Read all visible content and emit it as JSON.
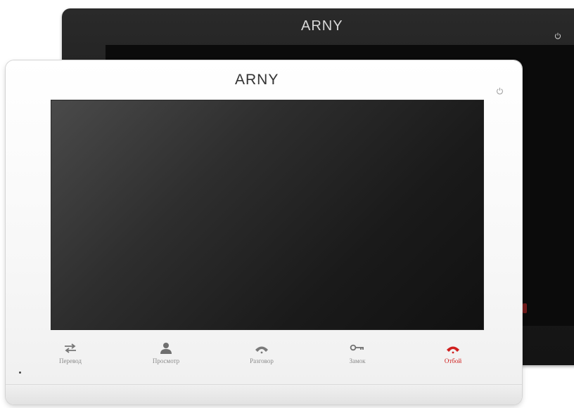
{
  "black_monitor": {
    "brand": "ARNY"
  },
  "white_monitor": {
    "brand": "ARNY",
    "buttons": [
      {
        "label": "Перевод",
        "icon": "transfer-arrows-icon",
        "color": "#8a8a8a"
      },
      {
        "label": "Просмотр",
        "icon": "person-icon",
        "color": "#8a8a8a"
      },
      {
        "label": "Разговор",
        "icon": "phone-handset-icon",
        "color": "#8a8a8a"
      },
      {
        "label": "Замок",
        "icon": "key-icon",
        "color": "#8a8a8a"
      },
      {
        "label": "Отбой",
        "icon": "hang-up-phone-icon",
        "color": "#d0201f"
      }
    ]
  },
  "colors": {
    "black_bezel": "#1c1c1c",
    "white_bezel": "#f7f7f7",
    "accent_red": "#d0201f"
  }
}
